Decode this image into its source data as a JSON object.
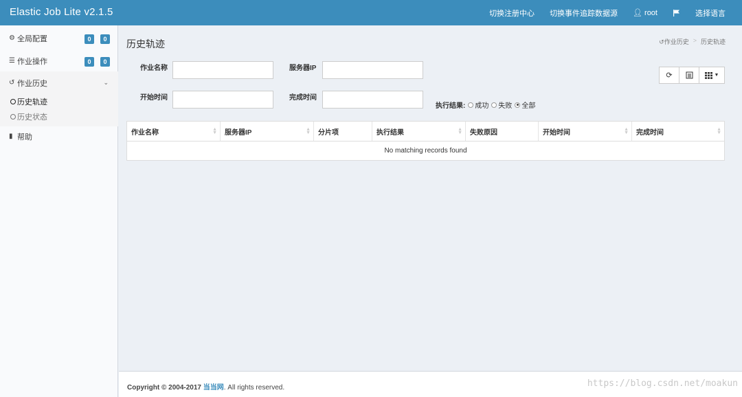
{
  "header": {
    "brand": "Elastic Job Lite v2.1.5",
    "nav": {
      "switch_registry": "切换注册中心",
      "switch_datasource": "切换事件追踪数据源",
      "user": "root",
      "language": "选择语言"
    }
  },
  "sidebar": {
    "global_config": {
      "label": "全局配置",
      "badge1": "0",
      "badge2": "0"
    },
    "job_ops": {
      "label": "作业操作",
      "badge1": "0",
      "badge2": "0"
    },
    "job_history": {
      "label": "作业历史"
    },
    "sub": {
      "trace": "历史轨迹",
      "status": "历史状态"
    },
    "help": "帮助"
  },
  "page": {
    "title": "历史轨迹",
    "breadcrumb": {
      "parent": "作业历史",
      "current": "历史轨迹"
    }
  },
  "form": {
    "job_name_label": "作业名称",
    "server_ip_label": "服务器IP",
    "start_time_label": "开始时间",
    "end_time_label": "完成时间",
    "job_name_value": "",
    "server_ip_value": "",
    "start_time_value": "",
    "end_time_value": "",
    "result_label": "执行结果:",
    "result_options": {
      "success": "成功",
      "fail": "失败",
      "all": "全部"
    },
    "result_selected": "all"
  },
  "table": {
    "columns": [
      "作业名称",
      "服务器IP",
      "分片项",
      "执行结果",
      "失败原因",
      "开始时间",
      "完成时间"
    ],
    "empty_message": "No matching records found"
  },
  "footer": {
    "prefix": "Copyright © 2004-2017 ",
    "link": "当当网",
    "suffix": ". All rights reserved.",
    "watermark": "https://blog.csdn.net/moakun"
  },
  "colors": {
    "primary": "#3c8dbc",
    "background": "#ecf0f5"
  }
}
